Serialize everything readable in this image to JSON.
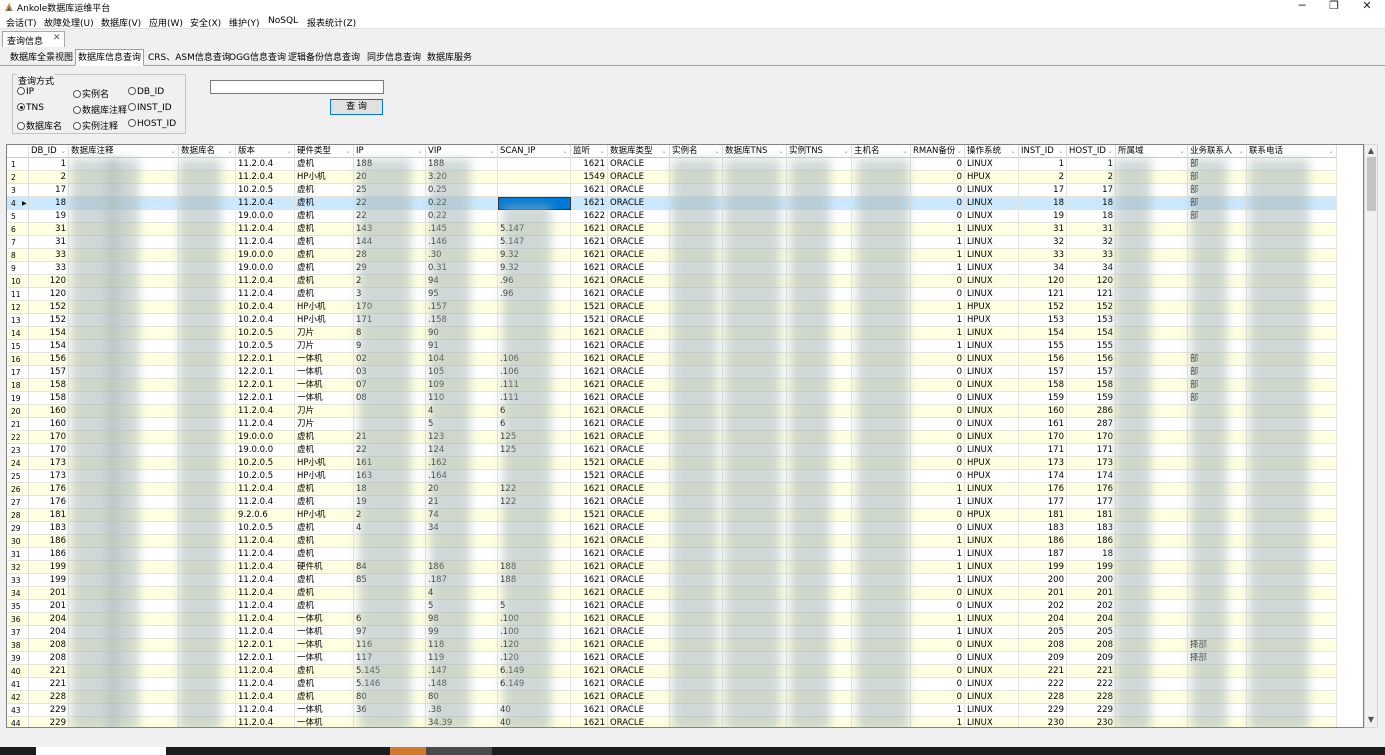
{
  "window": {
    "title": "Ankole数据库运维平台",
    "minimize": "─",
    "maximize": "❐",
    "close": "✕"
  },
  "menu": [
    "会话(T)",
    "故障处理(U)",
    "数据库(V)",
    "应用(W)",
    "安全(X)",
    "维护(Y)",
    "NoSQL",
    "报表统计(Z)"
  ],
  "doc_tab": {
    "label": "查询信息",
    "close": "✕"
  },
  "tabs": [
    {
      "label": "数据库全景视图",
      "active": false
    },
    {
      "label": "数据库信息查询",
      "active": true
    },
    {
      "label": "CRS、ASM信息查询",
      "active": false
    },
    {
      "label": "OGG信息查询",
      "active": false
    },
    {
      "label": "逻辑备份信息查询",
      "active": false
    },
    {
      "label": "同步信息查询",
      "active": false
    },
    {
      "label": "数据库服务",
      "active": false
    }
  ],
  "query": {
    "group_title": "查询方式",
    "options": [
      {
        "label": "IP",
        "checked": false
      },
      {
        "label": "实例名",
        "checked": false
      },
      {
        "label": "DB_ID",
        "checked": false
      },
      {
        "label": "TNS",
        "checked": true
      },
      {
        "label": "数据库注释",
        "checked": false
      },
      {
        "label": "INST_ID",
        "checked": false
      },
      {
        "label": "数据库名",
        "checked": false
      },
      {
        "label": "实例注释",
        "checked": false
      },
      {
        "label": "HOST_ID",
        "checked": false
      }
    ],
    "input_value": "",
    "button_label": "查 询"
  },
  "grid": {
    "columns": [
      "DB_ID",
      "数据库注释",
      "数据库名",
      "版本",
      "硬件类型",
      "IP",
      "VIP",
      "SCAN_IP",
      "监听",
      "数据库类型",
      "实例名",
      "数据库TNS",
      "实例TNS",
      "主机名",
      "RMAN备份",
      "操作系统",
      "INST_ID",
      "HOST_ID",
      "所属域",
      "业务联系人",
      "联系电话"
    ],
    "rows": [
      {
        "n": "1",
        "db_id": "1",
        "ver": "11.2.0.4",
        "hw": "虚机",
        "ip": "188",
        "vip": "188",
        "scan": "",
        "port": "1621",
        "type": "ORACLE",
        "rman": "0",
        "os": "LINUX",
        "inst": "1",
        "host": "1",
        "biz": "部"
      },
      {
        "n": "2",
        "db_id": "2",
        "ver": "11.2.0.4",
        "hw": "HP小机",
        "ip": "20",
        "vip": "3.20",
        "scan": "",
        "port": "1549",
        "type": "ORACLE",
        "rman": "0",
        "os": "HPUX",
        "inst": "2",
        "host": "2",
        "biz": "部"
      },
      {
        "n": "3",
        "db_id": "17",
        "ver": "10.2.0.5",
        "hw": "虚机",
        "ip": "25",
        "vip": "0.25",
        "scan": "",
        "port": "1621",
        "type": "ORACLE",
        "rman": "0",
        "os": "LINUX",
        "inst": "17",
        "host": "17",
        "biz": "部"
      },
      {
        "n": "4",
        "db_id": "18",
        "ver": "11.2.0.4",
        "hw": "虚机",
        "ip": "22",
        "vip": "0.22",
        "scan": "",
        "port": "1621",
        "type": "ORACLE",
        "rman": "0",
        "os": "LINUX",
        "inst": "18",
        "host": "18",
        "biz": "部"
      },
      {
        "n": "5",
        "db_id": "19",
        "ver": "19.0.0.0",
        "hw": "虚机",
        "ip": "22",
        "vip": "0.22",
        "scan": "",
        "port": "1622",
        "type": "ORACLE",
        "rman": "0",
        "os": "LINUX",
        "inst": "19",
        "host": "18",
        "biz": "部"
      },
      {
        "n": "6",
        "db_id": "31",
        "ver": "11.2.0.4",
        "hw": "虚机",
        "ip": "143",
        "vip": ".145",
        "scan": "5.147",
        "port": "1621",
        "type": "ORACLE",
        "rman": "1",
        "os": "LINUX",
        "inst": "31",
        "host": "31",
        "biz": ""
      },
      {
        "n": "7",
        "db_id": "31",
        "ver": "11.2.0.4",
        "hw": "虚机",
        "ip": "144",
        "vip": ".146",
        "scan": "5.147",
        "port": "1621",
        "type": "ORACLE",
        "rman": "1",
        "os": "LINUX",
        "inst": "32",
        "host": "32",
        "biz": ""
      },
      {
        "n": "8",
        "db_id": "33",
        "ver": "19.0.0.0",
        "hw": "虚机",
        "ip": "28",
        "vip": ".30",
        "scan": "9.32",
        "port": "1621",
        "type": "ORACLE",
        "rman": "1",
        "os": "LINUX",
        "inst": "33",
        "host": "33",
        "biz": ""
      },
      {
        "n": "9",
        "db_id": "33",
        "ver": "19.0.0.0",
        "hw": "虚机",
        "ip": "29",
        "vip": "0.31",
        "scan": "9.32",
        "port": "1621",
        "type": "ORACLE",
        "rman": "1",
        "os": "LINUX",
        "inst": "34",
        "host": "34",
        "biz": ""
      },
      {
        "n": "10",
        "db_id": "120",
        "ver": "11.2.0.4",
        "hw": "虚机",
        "ip": "2",
        "vip": "94",
        "scan": ".96",
        "port": "1621",
        "type": "ORACLE",
        "rman": "0",
        "os": "LINUX",
        "inst": "120",
        "host": "120",
        "biz": ""
      },
      {
        "n": "11",
        "db_id": "120",
        "ver": "11.2.0.4",
        "hw": "虚机",
        "ip": "3",
        "vip": "95",
        "scan": ".96",
        "port": "1621",
        "type": "ORACLE",
        "rman": "0",
        "os": "LINUX",
        "inst": "121",
        "host": "121",
        "biz": ""
      },
      {
        "n": "12",
        "db_id": "152",
        "ver": "10.2.0.4",
        "hw": "HP小机",
        "ip": "170",
        "vip": ".157",
        "scan": "",
        "port": "1521",
        "type": "ORACLE",
        "rman": "1",
        "os": "HPUX",
        "inst": "152",
        "host": "152",
        "biz": ""
      },
      {
        "n": "13",
        "db_id": "152",
        "ver": "10.2.0.4",
        "hw": "HP小机",
        "ip": "171",
        "vip": ".158",
        "scan": "",
        "port": "1521",
        "type": "ORACLE",
        "rman": "1",
        "os": "HPUX",
        "inst": "153",
        "host": "153",
        "biz": ""
      },
      {
        "n": "14",
        "db_id": "154",
        "ver": "10.2.0.5",
        "hw": "刀片",
        "ip": "8",
        "vip": "90",
        "scan": "",
        "port": "1621",
        "type": "ORACLE",
        "rman": "1",
        "os": "LINUX",
        "inst": "154",
        "host": "154",
        "biz": ""
      },
      {
        "n": "15",
        "db_id": "154",
        "ver": "10.2.0.5",
        "hw": "刀片",
        "ip": "9",
        "vip": "91",
        "scan": "",
        "port": "1621",
        "type": "ORACLE",
        "rman": "1",
        "os": "LINUX",
        "inst": "155",
        "host": "155",
        "biz": ""
      },
      {
        "n": "16",
        "db_id": "156",
        "ver": "12.2.0.1",
        "hw": "一体机",
        "ip": "02",
        "vip": "104",
        "scan": ".106",
        "port": "1621",
        "type": "ORACLE",
        "rman": "0",
        "os": "LINUX",
        "inst": "156",
        "host": "156",
        "biz": "部"
      },
      {
        "n": "17",
        "db_id": "157",
        "ver": "12.2.0.1",
        "hw": "一体机",
        "ip": "03",
        "vip": "105",
        "scan": ".106",
        "port": "1621",
        "type": "ORACLE",
        "rman": "0",
        "os": "LINUX",
        "inst": "157",
        "host": "157",
        "biz": "部"
      },
      {
        "n": "18",
        "db_id": "158",
        "ver": "12.2.0.1",
        "hw": "一体机",
        "ip": "07",
        "vip": "109",
        "scan": ".111",
        "port": "1621",
        "type": "ORACLE",
        "rman": "0",
        "os": "LINUX",
        "inst": "158",
        "host": "158",
        "biz": "部"
      },
      {
        "n": "19",
        "db_id": "158",
        "ver": "12.2.0.1",
        "hw": "一体机",
        "ip": "08",
        "vip": "110",
        "scan": ".111",
        "port": "1621",
        "type": "ORACLE",
        "rman": "0",
        "os": "LINUX",
        "inst": "159",
        "host": "159",
        "biz": "部"
      },
      {
        "n": "20",
        "db_id": "160",
        "ver": "11.2.0.4",
        "hw": "刀片",
        "ip": "",
        "vip": "4",
        "scan": "6",
        "port": "1621",
        "type": "ORACLE",
        "rman": "0",
        "os": "LINUX",
        "inst": "160",
        "host": "286",
        "biz": ""
      },
      {
        "n": "21",
        "db_id": "160",
        "ver": "11.2.0.4",
        "hw": "刀片",
        "ip": "",
        "vip": "5",
        "scan": "6",
        "port": "1621",
        "type": "ORACLE",
        "rman": "0",
        "os": "LINUX",
        "inst": "161",
        "host": "287",
        "biz": ""
      },
      {
        "n": "22",
        "db_id": "170",
        "ver": "19.0.0.0",
        "hw": "虚机",
        "ip": "21",
        "vip": "123",
        "scan": "125",
        "port": "1621",
        "type": "ORACLE",
        "rman": "0",
        "os": "LINUX",
        "inst": "170",
        "host": "170",
        "biz": ""
      },
      {
        "n": "23",
        "db_id": "170",
        "ver": "19.0.0.0",
        "hw": "虚机",
        "ip": "22",
        "vip": "124",
        "scan": "125",
        "port": "1621",
        "type": "ORACLE",
        "rman": "0",
        "os": "LINUX",
        "inst": "171",
        "host": "171",
        "biz": ""
      },
      {
        "n": "24",
        "db_id": "173",
        "ver": "10.2.0.5",
        "hw": "HP小机",
        "ip": "161",
        "vip": ".162",
        "scan": "",
        "port": "1521",
        "type": "ORACLE",
        "rman": "0",
        "os": "HPUX",
        "inst": "173",
        "host": "173",
        "biz": ""
      },
      {
        "n": "25",
        "db_id": "173",
        "ver": "10.2.0.5",
        "hw": "HP小机",
        "ip": "163",
        "vip": ".164",
        "scan": "",
        "port": "1521",
        "type": "ORACLE",
        "rman": "0",
        "os": "HPUX",
        "inst": "174",
        "host": "174",
        "biz": ""
      },
      {
        "n": "26",
        "db_id": "176",
        "ver": "11.2.0.4",
        "hw": "虚机",
        "ip": "18",
        "vip": "20",
        "scan": "122",
        "port": "1621",
        "type": "ORACLE",
        "rman": "1",
        "os": "LINUX",
        "inst": "176",
        "host": "176",
        "biz": ""
      },
      {
        "n": "27",
        "db_id": "176",
        "ver": "11.2.0.4",
        "hw": "虚机",
        "ip": "19",
        "vip": "21",
        "scan": "122",
        "port": "1621",
        "type": "ORACLE",
        "rman": "1",
        "os": "LINUX",
        "inst": "177",
        "host": "177",
        "biz": ""
      },
      {
        "n": "28",
        "db_id": "181",
        "ver": "9.2.0.6",
        "hw": "HP小机",
        "ip": "2",
        "vip": "74",
        "scan": "",
        "port": "1521",
        "type": "ORACLE",
        "rman": "0",
        "os": "HPUX",
        "inst": "181",
        "host": "181",
        "biz": ""
      },
      {
        "n": "29",
        "db_id": "183",
        "ver": "10.2.0.5",
        "hw": "虚机",
        "ip": "4",
        "vip": "34",
        "scan": "",
        "port": "1621",
        "type": "ORACLE",
        "rman": "0",
        "os": "LINUX",
        "inst": "183",
        "host": "183",
        "biz": ""
      },
      {
        "n": "30",
        "db_id": "186",
        "ver": "11.2.0.4",
        "hw": "虚机",
        "ip": "",
        "vip": "",
        "scan": "",
        "port": "1621",
        "type": "ORACLE",
        "rman": "1",
        "os": "LINUX",
        "inst": "186",
        "host": "186",
        "biz": ""
      },
      {
        "n": "31",
        "db_id": "186",
        "ver": "11.2.0.4",
        "hw": "虚机",
        "ip": "",
        "vip": "",
        "scan": "",
        "port": "1621",
        "type": "ORACLE",
        "rman": "1",
        "os": "LINUX",
        "inst": "187",
        "host": "18",
        "biz": ""
      },
      {
        "n": "32",
        "db_id": "199",
        "ver": "11.2.0.4",
        "hw": "硬件机",
        "ip": "84",
        "vip": "186",
        "scan": "188",
        "port": "1621",
        "type": "ORACLE",
        "rman": "1",
        "os": "LINUX",
        "inst": "199",
        "host": "199",
        "biz": ""
      },
      {
        "n": "33",
        "db_id": "199",
        "ver": "11.2.0.4",
        "hw": "虚机",
        "ip": "85",
        "vip": ".187",
        "scan": "188",
        "port": "1621",
        "type": "ORACLE",
        "rman": "1",
        "os": "LINUX",
        "inst": "200",
        "host": "200",
        "biz": ""
      },
      {
        "n": "34",
        "db_id": "201",
        "ver": "11.2.0.4",
        "hw": "虚机",
        "ip": "",
        "vip": "4",
        "scan": "",
        "port": "1621",
        "type": "ORACLE",
        "rman": "0",
        "os": "LINUX",
        "inst": "201",
        "host": "201",
        "biz": ""
      },
      {
        "n": "35",
        "db_id": "201",
        "ver": "11.2.0.4",
        "hw": "虚机",
        "ip": "",
        "vip": "5",
        "scan": "5",
        "port": "1621",
        "type": "ORACLE",
        "rman": "0",
        "os": "LINUX",
        "inst": "202",
        "host": "202",
        "biz": ""
      },
      {
        "n": "36",
        "db_id": "204",
        "ver": "11.2.0.4",
        "hw": "一体机",
        "ip": "6",
        "vip": "98",
        "scan": ".100",
        "port": "1621",
        "type": "ORACLE",
        "rman": "1",
        "os": "LINUX",
        "inst": "204",
        "host": "204",
        "biz": ""
      },
      {
        "n": "37",
        "db_id": "204",
        "ver": "11.2.0.4",
        "hw": "一体机",
        "ip": "97",
        "vip": "99",
        "scan": ".100",
        "port": "1621",
        "type": "ORACLE",
        "rman": "1",
        "os": "LINUX",
        "inst": "205",
        "host": "205",
        "biz": ""
      },
      {
        "n": "38",
        "db_id": "208",
        "ver": "12.2.0.1",
        "hw": "一体机",
        "ip": "116",
        "vip": "118",
        "scan": ".120",
        "port": "1621",
        "type": "ORACLE",
        "rman": "0",
        "os": "LINUX",
        "inst": "208",
        "host": "208",
        "biz": "择部"
      },
      {
        "n": "39",
        "db_id": "208",
        "ver": "12.2.0.1",
        "hw": "一体机",
        "ip": "117",
        "vip": "119",
        "scan": ".120",
        "port": "1621",
        "type": "ORACLE",
        "rman": "0",
        "os": "LINUX",
        "inst": "209",
        "host": "209",
        "biz": "择部"
      },
      {
        "n": "40",
        "db_id": "221",
        "ver": "11.2.0.4",
        "hw": "虚机",
        "ip": "5.145",
        "vip": ".147",
        "scan": "6.149",
        "port": "1621",
        "type": "ORACLE",
        "rman": "0",
        "os": "LINUX",
        "inst": "221",
        "host": "221",
        "biz": ""
      },
      {
        "n": "41",
        "db_id": "221",
        "ver": "11.2.0.4",
        "hw": "虚机",
        "ip": "5.146",
        "vip": ".148",
        "scan": "6.149",
        "port": "1621",
        "type": "ORACLE",
        "rman": "0",
        "os": "LINUX",
        "inst": "222",
        "host": "222",
        "biz": ""
      },
      {
        "n": "42",
        "db_id": "228",
        "ver": "11.2.0.4",
        "hw": "虚机",
        "ip": "80",
        "vip": "80",
        "scan": "",
        "port": "1621",
        "type": "ORACLE",
        "rman": "0",
        "os": "LINUX",
        "inst": "228",
        "host": "228",
        "biz": ""
      },
      {
        "n": "43",
        "db_id": "229",
        "ver": "11.2.0.4",
        "hw": "一体机",
        "ip": "36",
        "vip": ".38",
        "scan": "40",
        "port": "1621",
        "type": "ORACLE",
        "rman": "1",
        "os": "LINUX",
        "inst": "229",
        "host": "229",
        "biz": ""
      },
      {
        "n": "44",
        "db_id": "229",
        "ver": "11.2.0.4",
        "hw": "一体机",
        "ip": "",
        "vip": "34.39",
        "scan": "40",
        "port": "1621",
        "type": "ORACLE",
        "rman": "1",
        "os": "LINUX",
        "inst": "230",
        "host": "230",
        "biz": ""
      }
    ]
  },
  "colors": {
    "accent": "#0078d7",
    "row_odd": "#ffffff",
    "row_even": "#ffffe1",
    "row_selected": "#cce8ff"
  }
}
